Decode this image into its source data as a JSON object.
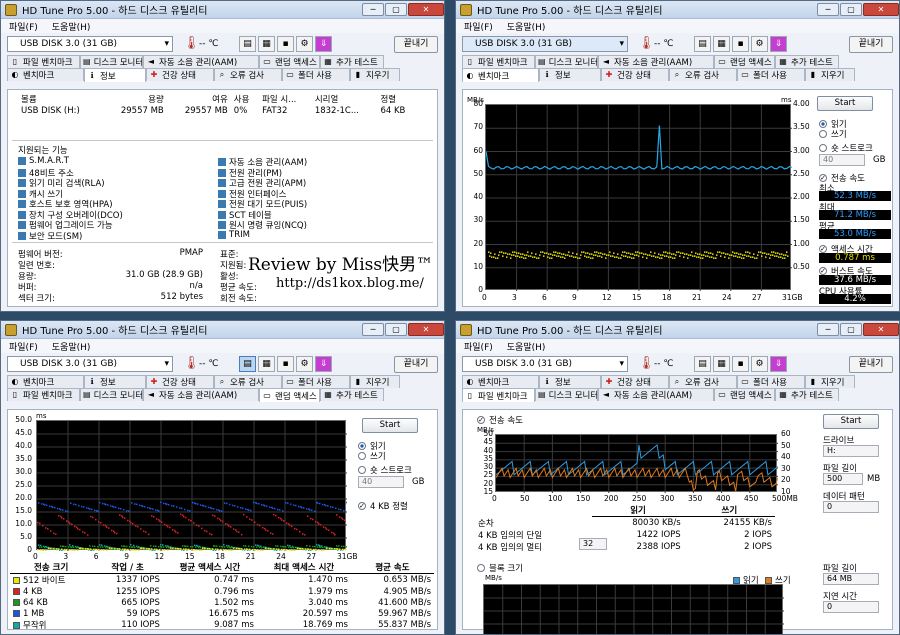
{
  "app": {
    "title": "HD Tune Pro 5.00 - 하드 디스크 유틸리티",
    "min": "─",
    "max": "▢",
    "close": "✕"
  },
  "menu": {
    "file": "파일(F)",
    "help": "도움말(H)"
  },
  "toolbar": {
    "drive": "USB DISK 3.0     (31 GB)",
    "temp": "-- ℃",
    "exit": "끝내기"
  },
  "tabs": {
    "row_upper": [
      "벤치마크",
      "정보",
      "건강 상태",
      "오류 검사",
      "폴더 사용",
      "지우기"
    ],
    "row_lower": [
      "파일 벤치마크",
      "디스크 모니터",
      "자동 소음 관리(AAM)",
      "랜덤 액세스",
      "추가 테스트"
    ]
  },
  "info": {
    "headers": [
      "볼륨",
      "용량",
      "여유",
      "사용",
      "파일 시...",
      "시리얼",
      "정렬"
    ],
    "row": [
      "USB DISK (H:)",
      "29557 MB",
      "29557 MB",
      "0%",
      "FAT32",
      "1832-1C...",
      "64 KB"
    ],
    "features_title": "지원되는 기능",
    "features_left": [
      "S.M.A.R.T",
      "48비트 주소",
      "읽기 미리 검색(RLA)",
      "캐시 쓰기",
      "호스트 보호 영역(HPA)",
      "장치 구성 오버레이(DCO)",
      "펌웨어 업그레이드 가능",
      "보안 모드(SM)"
    ],
    "features_right": [
      "자동 소음 관리(AAM)",
      "전원 관리(PM)",
      "고급 전원 관리(APM)",
      "전원 인터페이스",
      "전원 대기 모드(PUIS)",
      "SCT 테이블",
      "원시 명령 큐잉(NCQ)",
      "TRIM"
    ],
    "details_left": [
      [
        "펌웨어 버전:",
        "PMAP"
      ],
      [
        "일련 번호:",
        ""
      ],
      [
        "용량:",
        "31.0 GB (28.9 GB)"
      ],
      [
        "버퍼:",
        "n/a"
      ],
      [
        "섹터 크기:",
        "512 bytes"
      ]
    ],
    "details_right": [
      "표준:",
      "지원됨:",
      "활성:",
      "평균 속도:",
      "회전 속도:"
    ],
    "watermark_line1": "Review by Miss快男™",
    "watermark_line2": "http://ds1kox.blog.me/"
  },
  "benchmark": {
    "start": "Start",
    "y_unit_left": "MB/s",
    "y_unit_right": "ms",
    "y_left": [
      "80",
      "70",
      "60",
      "50",
      "40",
      "30",
      "20",
      "10",
      "0"
    ],
    "y_right": [
      "4.00",
      "3.50",
      "3.00",
      "2.50",
      "2.00",
      "1.50",
      "1.00",
      "0.50",
      ""
    ],
    "x": [
      "0",
      "3",
      "6",
      "9",
      "12",
      "15",
      "18",
      "21",
      "24",
      "27",
      "31GB"
    ],
    "read": "읽기",
    "write": "쓰기",
    "short_stroke": "숏 스트로크",
    "stroke_value": "40",
    "stroke_unit": "GB",
    "transfer_rate": "전송 속도",
    "min_label": "최소",
    "min": "52.3 MB/s",
    "max_label": "최대",
    "max": "71.2 MB/s",
    "avg_label": "평균",
    "avg": "53.0 MB/s",
    "access_label": "액세스 시간",
    "access": "0.787 ms",
    "burst_label": "버스트 속도",
    "burst": "37.6 MB/s",
    "cpu_label": "CPU 사용률",
    "cpu": "4.2%",
    "chart_data": {
      "type": "line",
      "x": [
        0,
        3,
        6,
        9,
        12,
        15,
        18,
        21,
        24,
        27,
        31
      ],
      "xlabel": "",
      "ylabel": "MB/s",
      "ylim": [
        0,
        80
      ],
      "series": [
        {
          "name": "전송 속도",
          "values": [
            53,
            53,
            53,
            53,
            53,
            53,
            53,
            53,
            53,
            53,
            53
          ]
        }
      ]
    }
  },
  "random": {
    "start": "Start",
    "y_unit": "ms",
    "y": [
      "50.0",
      "45.0",
      "40.0",
      "35.0",
      "30.0",
      "25.0",
      "20.0",
      "15.0",
      "10.0",
      "5.0",
      "0"
    ],
    "x": [
      "0",
      "3",
      "6",
      "9",
      "12",
      "15",
      "18",
      "21",
      "24",
      "27",
      "31GB"
    ],
    "read": "읽기",
    "write": "쓰기",
    "short_stroke": "숏 스트로크",
    "stroke_value": "40",
    "stroke_unit": "GB",
    "align": "4 KB 정렬",
    "headers": [
      "전송 크기",
      "작업 / 초",
      "평균 액세스 시간",
      "최대 액세스 시간",
      "평균 속도"
    ],
    "rows": [
      [
        "512 바이트",
        "1337 IOPS",
        "0.747 ms",
        "1.470 ms",
        "0.653 MB/s"
      ],
      [
        "4 KB",
        "1255 IOPS",
        "0.796 ms",
        "1.979 ms",
        "4.905 MB/s"
      ],
      [
        "64 KB",
        "665 IOPS",
        "1.502 ms",
        "3.040 ms",
        "41.600 MB/s"
      ],
      [
        "1 MB",
        "59 IOPS",
        "16.675 ms",
        "20.597 ms",
        "59.967 MB/s"
      ],
      [
        "무작위",
        "110 IOPS",
        "9.087 ms",
        "18.769 ms",
        "55.837 MB/s"
      ]
    ],
    "colors": [
      "#e8e800",
      "#e02020",
      "#1c9a1c",
      "#1858e8",
      "#10a8a8"
    ]
  },
  "filebench": {
    "transfer": "전송 속도",
    "y_unit": "MB/s",
    "y_left": [
      "50",
      "45",
      "40",
      "35",
      "30",
      "25",
      "20",
      "15"
    ],
    "y_right": [
      "60",
      "50",
      "40",
      "30",
      "20",
      "10"
    ],
    "x": [
      "0",
      "50",
      "100",
      "150",
      "200",
      "250",
      "300",
      "350",
      "400",
      "450",
      "500MB"
    ],
    "col_read": "읽기",
    "col_write": "쓰기",
    "rows": [
      [
        "순차",
        "80030 KB/s",
        "24155 KB/s"
      ],
      [
        "4 KB 임의의 단일",
        "1422 IOPS",
        "2 IOPS"
      ],
      [
        "4 KB 임의의 멀티",
        "2388 IOPS",
        "2 IOPS"
      ]
    ],
    "queue": "32",
    "block": "블록 크기",
    "legend_read": "읽기",
    "legend_write": "쓰기",
    "start": "Start",
    "drive_label": "드라이브",
    "drive": "H:",
    "file_len_label": "파일 길이",
    "file_len": "500",
    "file_len_unit": "MB",
    "pattern_label": "데이터 패턴",
    "pattern": "0",
    "file_len2_label": "파일 길이",
    "file_len2": "64 MB",
    "delay_label": "지연 시간",
    "delay": "0"
  }
}
